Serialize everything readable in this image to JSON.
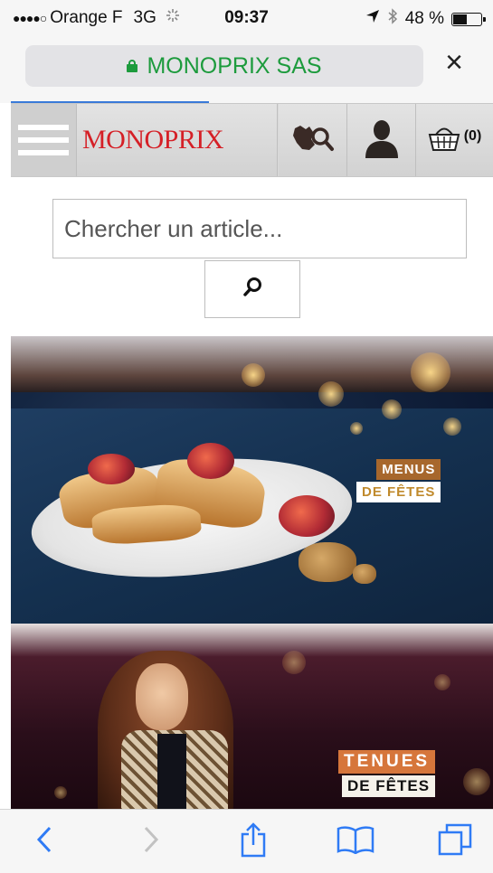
{
  "status_bar": {
    "signal_dots": "●●●●○",
    "carrier": "Orange F",
    "network": "3G",
    "time": "09:37",
    "battery_pct": "48 %",
    "battery_level": 0.48
  },
  "url_bar": {
    "title": "MONOPRIX SAS",
    "secure_color": "#1d9b3d",
    "close_glyph": "×",
    "load_progress": 0.41
  },
  "site_nav": {
    "logo_text": "MONOPRIX",
    "logo_color": "#d51f26",
    "cart_count": "(0)",
    "icons": [
      "menu-icon",
      "store-locator-icon",
      "account-icon",
      "cart-icon"
    ]
  },
  "search": {
    "placeholder": "Chercher un article...",
    "button_icon": "search-icon"
  },
  "banners": [
    {
      "line1": "MENUS",
      "line2": "DE FÊTES"
    },
    {
      "line1": "TENUES",
      "line2": "DE FÊTES"
    }
  ],
  "toolbar": {
    "buttons": [
      "back-icon",
      "forward-icon",
      "share-icon",
      "bookmarks-icon",
      "tabs-icon"
    ],
    "accent": "#2f7bf5",
    "disabled": "#c2c2c2"
  }
}
